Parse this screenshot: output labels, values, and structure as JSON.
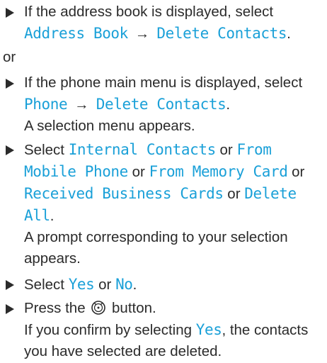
{
  "steps": {
    "s1": {
      "text_pre": "If the address book is displayed, select",
      "menu_a": "Address Book",
      "arrow": "→",
      "menu_b": "Delete Contacts",
      "end": "."
    },
    "or": "or",
    "s2": {
      "text_pre": "If the phone main menu is displayed, select",
      "menu_a": "Phone",
      "arrow": "→",
      "menu_b": "Delete Contacts",
      "end": ".",
      "result": "A selection menu appears."
    },
    "s3": {
      "text_pre": "Select",
      "opt1": "Internal Contacts",
      "or1": "or",
      "opt2": "From Mobile Phone",
      "or2": "or",
      "opt3": "From Memory Card",
      "or3": "or",
      "opt4": "Received Business Cards",
      "or4": "or",
      "opt5": "Delete All",
      "end": ".",
      "result": "A prompt corresponding to your selection appears."
    },
    "s4": {
      "text_pre": "Select",
      "yes": "Yes",
      "or": "or",
      "no": "No",
      "end": "."
    },
    "s5": {
      "text_pre": "Press the",
      "button_icon": "rotary-push-button-icon",
      "text_post": "button.",
      "result_pre": "If you confirm by selecting",
      "result_yes": "Yes",
      "result_post": ", the contacts you have selected are deleted."
    }
  },
  "colors": {
    "ui_text": "#1aa0d8",
    "body_text": "#2b2b2b"
  }
}
